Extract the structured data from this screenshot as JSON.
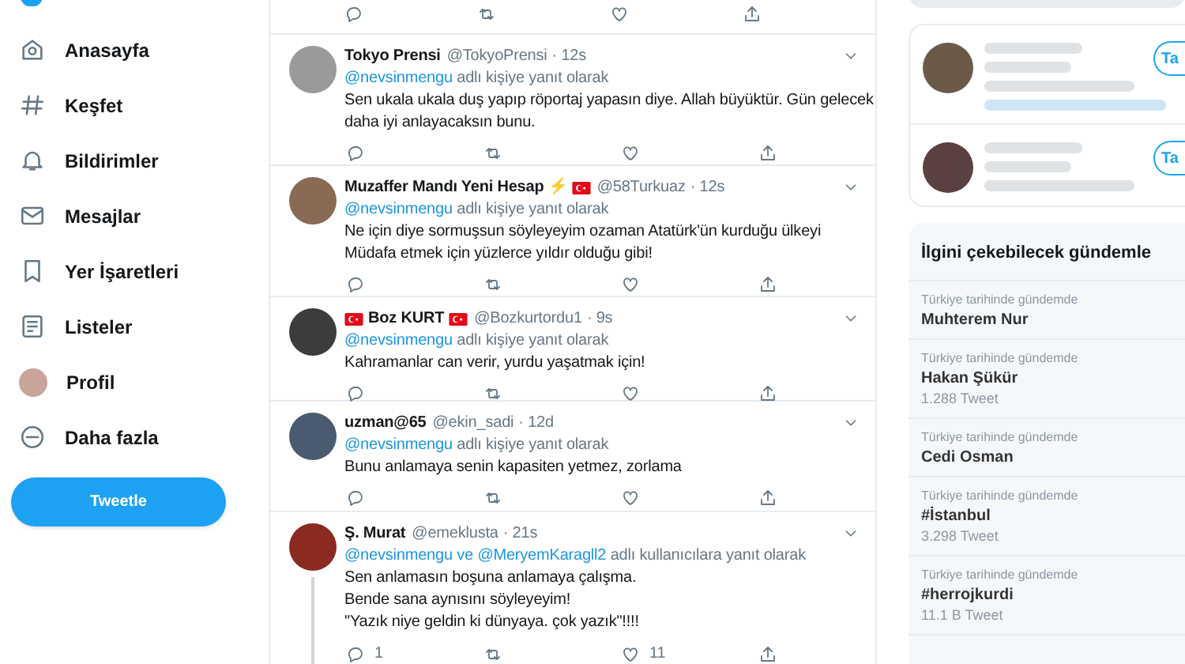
{
  "nav": {
    "items": [
      {
        "label": "Anasayfa"
      },
      {
        "label": "Keşfet"
      },
      {
        "label": "Bildirimler"
      },
      {
        "label": "Mesajlar"
      },
      {
        "label": "Yer İşaretleri"
      },
      {
        "label": "Listeler"
      },
      {
        "label": "Profil"
      },
      {
        "label": "Daha fazla"
      }
    ],
    "tweet_button": "Tweetle"
  },
  "timeline": {
    "previous_tweet_actions_visible": true,
    "tweets": [
      {
        "name": "Tokyo Prensi",
        "name_flag_before": false,
        "name_flag_after": false,
        "handle": "@TokyoPrensi",
        "time": "· 12s",
        "reply_line": [
          {
            "kind": "mention",
            "text": "@nevsinmengu"
          },
          {
            "kind": "plain",
            "text": "adlı kişiye yanıt olarak"
          }
        ],
        "lines": [
          "Sen ukala ukala duş yapıp röportaj yapasın diye. Allah büyüktür. Gün gelecek",
          "daha iyi anlayacaksın bunu."
        ],
        "thread_line": false
      },
      {
        "name": "Muzaffer Mandı Yeni Hesap ⚡",
        "name_flag_before": false,
        "name_flag_after": true,
        "handle": "@58Turkuaz",
        "time": "· 12s",
        "reply_line": [
          {
            "kind": "mention",
            "text": "@nevsinmengu"
          },
          {
            "kind": "plain",
            "text": "adlı kişiye yanıt olarak"
          }
        ],
        "lines": [
          "Ne için diye sormuşsun söyleyeyim ozaman Atatürk'ün kurduğu ülkeyi",
          "Müdafa etmek için yüzlerce yıldır olduğu gibi!"
        ],
        "thread_line": false
      },
      {
        "name": "Boz KURT",
        "name_flag_before": true,
        "name_flag_after": true,
        "handle": "@Bozkurtordu1",
        "time": "· 9s",
        "reply_line": [
          {
            "kind": "mention",
            "text": "@nevsinmengu"
          },
          {
            "kind": "plain",
            "text": "adlı kişiye yanıt olarak"
          }
        ],
        "lines": [
          "Kahramanlar can verir, yurdu yaşatmak için!"
        ],
        "thread_line": false
      },
      {
        "name": "uzman@65",
        "name_flag_before": false,
        "name_flag_after": false,
        "handle": "@ekin_sadi",
        "time": "· 12d",
        "reply_line": [
          {
            "kind": "mention",
            "text": "@nevsinmengu"
          },
          {
            "kind": "plain",
            "text": "adlı kişiye yanıt olarak"
          }
        ],
        "lines": [
          "Bunu anlamaya senin kapasiten yetmez, zorlama"
        ],
        "thread_line": false
      },
      {
        "name": "Ş. Murat",
        "name_flag_before": false,
        "name_flag_after": false,
        "handle": "@emeklusta",
        "time": "· 21s",
        "reply_line": [
          {
            "kind": "mention",
            "text": "@nevsinmengu"
          },
          {
            "kind": "mention",
            "text": "ve"
          },
          {
            "kind": "mention",
            "text": "@MeryemKaragll2"
          },
          {
            "kind": "plain",
            "text": "adlı kullanıcılara yanıt olarak"
          }
        ],
        "lines": [
          "Sen anlamasın boşuna anlamaya çalışma.",
          "Bende sana aynısını söyleyeyim!",
          "\"Yazık niye geldin ki dünyaya. çok yazık\"!!!!"
        ],
        "thread_line": true,
        "reply_count": "1",
        "like_count": "11"
      }
    ]
  },
  "sidebar": {
    "follow_suggestions": [
      {
        "button": "Ta"
      },
      {
        "button": "Ta"
      }
    ],
    "trends": {
      "title": "İlgini çekebilecek gündemle",
      "items": [
        {
          "context": "Türkiye tarihinde gündemde",
          "name": "Muhterem Nur"
        },
        {
          "context": "Türkiye tarihinde gündemde",
          "name": "Hakan Şükür",
          "count": "1.288 Tweet"
        },
        {
          "context": "Türkiye tarihinde gündemde",
          "name": "Cedi Osman"
        },
        {
          "context": "Türkiye tarihinde gündemde",
          "name": "#İstanbul",
          "count": "3.298 Tweet"
        },
        {
          "context": "Türkiye tarihinde gündemde",
          "name": "#herrojkurdi",
          "count": "11.1 B Tweet"
        }
      ]
    }
  }
}
